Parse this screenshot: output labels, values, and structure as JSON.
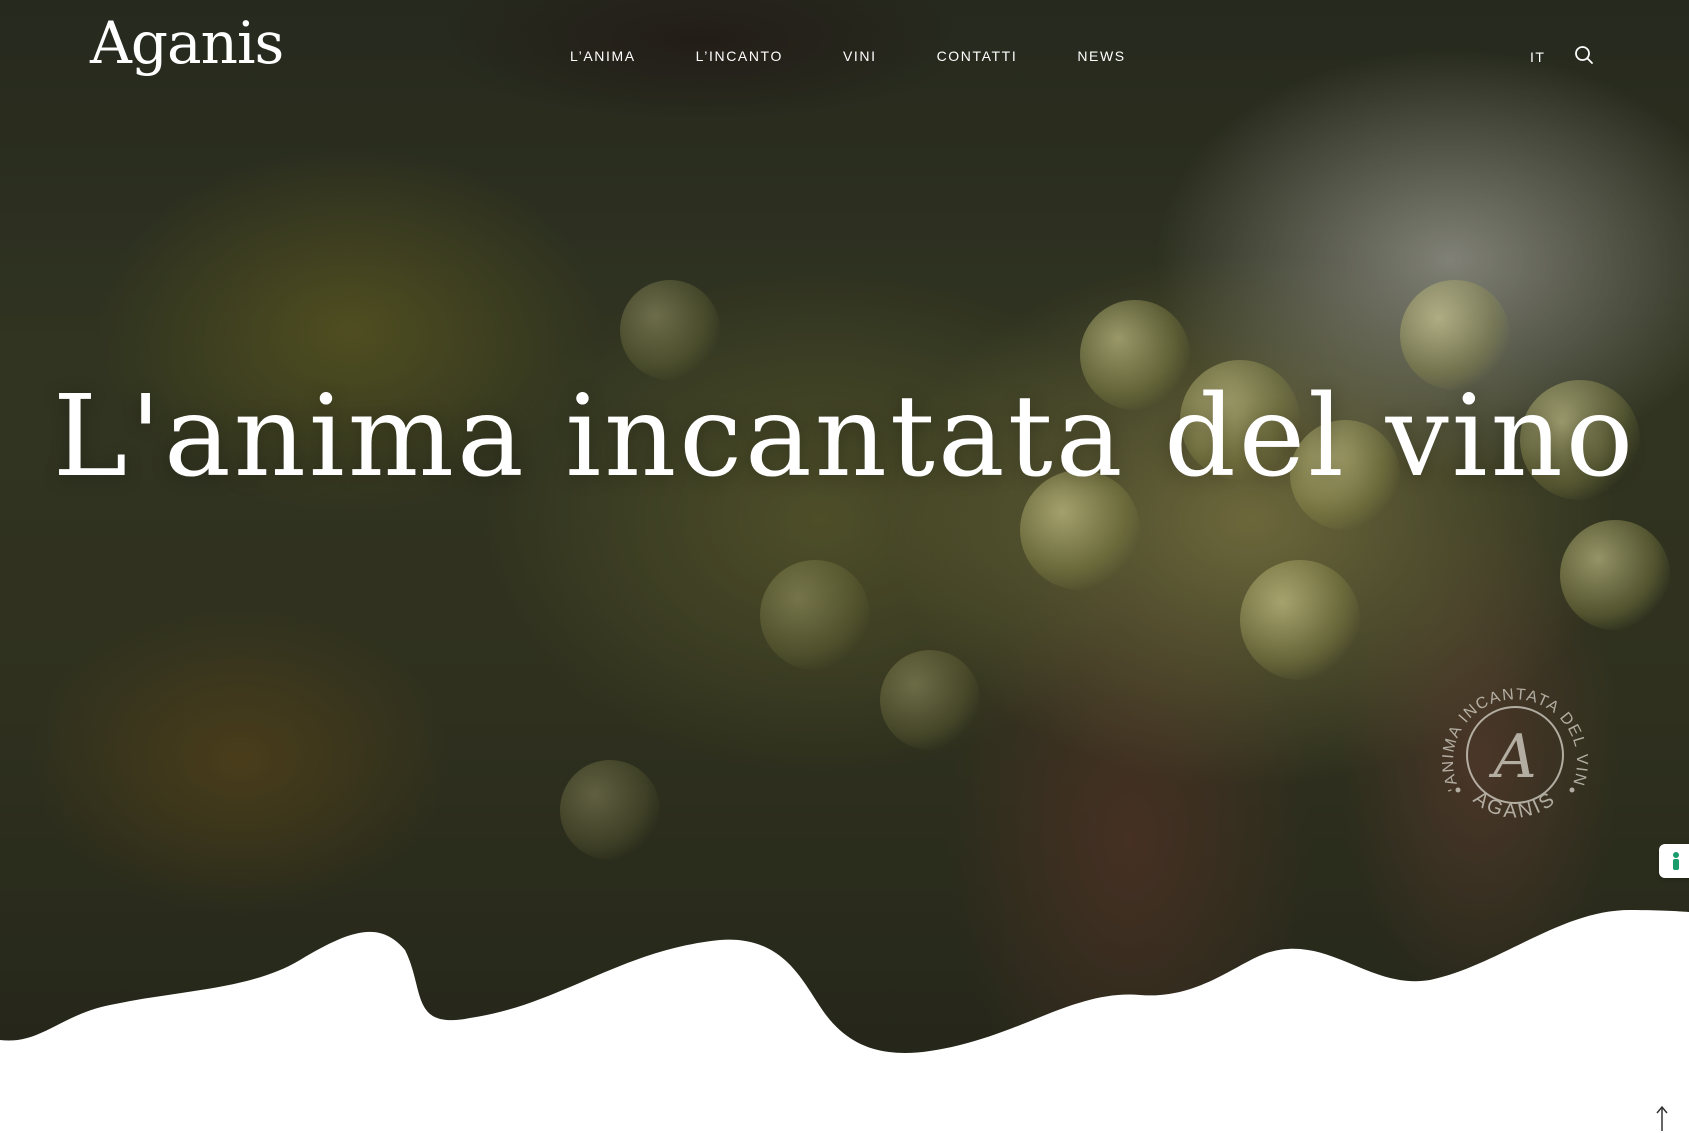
{
  "brand": {
    "logo_text": "Aganis"
  },
  "nav": {
    "items": [
      {
        "label": "L’ANIMA"
      },
      {
        "label": "L’INCANTO"
      },
      {
        "label": "VINI"
      },
      {
        "label": "CONTATTI"
      },
      {
        "label": "NEWS"
      }
    ],
    "language": "IT",
    "search_icon": "search-icon"
  },
  "hero": {
    "title": "L'anima incantata del vino",
    "badge": {
      "ring_text": "L'ANIMA INCANTATA DEL VINO",
      "bottom_text": "AGANIS",
      "monogram": "A"
    }
  },
  "floating": {
    "side_tab_icon": "privacy-icon",
    "scroll_top_icon": "arrow-up-icon"
  },
  "colors": {
    "text_on_hero": "#ffffff",
    "wave": "#ffffff",
    "side_tab_accent": "#1a9b6b"
  }
}
